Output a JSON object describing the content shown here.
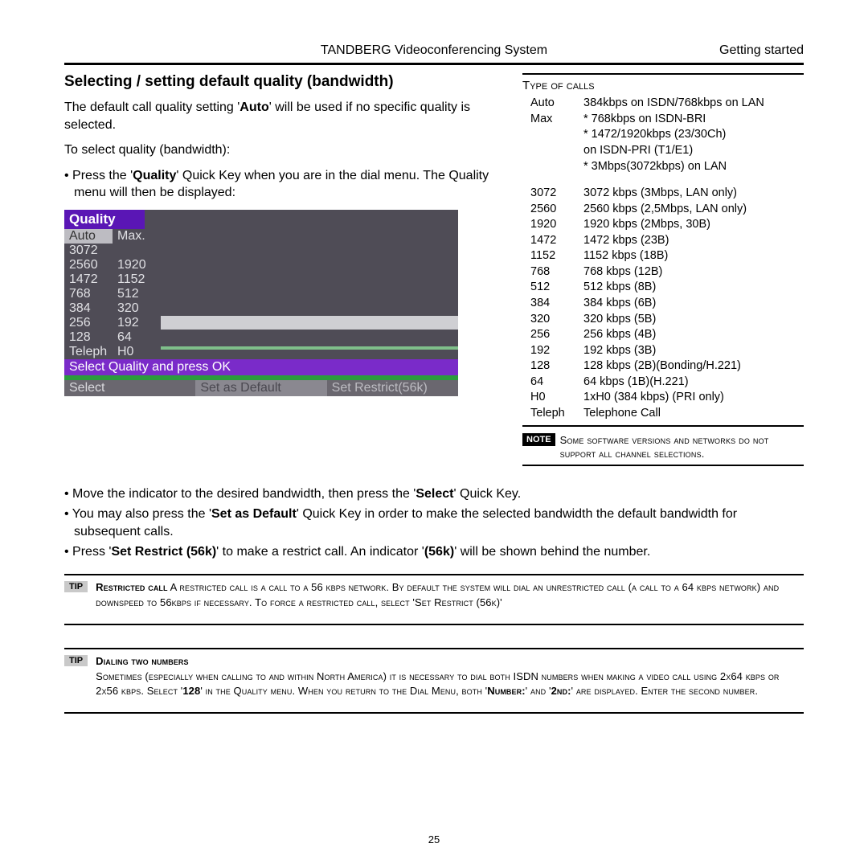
{
  "header": {
    "title": "TANDBERG Videoconferencing System",
    "right": "Getting started"
  },
  "section_heading": "Selecting / setting default quality (bandwidth)",
  "intro": {
    "p1a": "The default call quality setting '",
    "p1b": "Auto",
    "p1c": "' will be used if no specific quality is selected.",
    "p2": "To select quality (bandwidth):",
    "b1a": "Press the '",
    "b1b": "Quality",
    "b1c": "' Quick Key when you are in the dial menu. The Quality menu will then be displayed:"
  },
  "qmenu": {
    "title": "Quality",
    "rows": [
      [
        "Auto",
        "Max."
      ],
      [
        "3072",
        ""
      ],
      [
        "2560",
        "1920"
      ],
      [
        "1472",
        "1152"
      ],
      [
        "768",
        "512"
      ],
      [
        "384",
        "320"
      ],
      [
        "256",
        "192"
      ],
      [
        "128",
        "64"
      ],
      [
        "Teleph",
        "H0"
      ]
    ],
    "instruction": "Select Quality and press OK",
    "softkeys": [
      "Select",
      "Set as Default",
      "Set Restrict(56k)"
    ]
  },
  "toc": {
    "header": "Type of calls",
    "rows": [
      [
        "Auto",
        "384kbps on ISDN/768kbps on LAN"
      ],
      [
        "Max",
        "* 768kbps on ISDN-BRI"
      ],
      [
        "",
        "* 1472/1920kbps (23/30Ch)"
      ],
      [
        "",
        " on ISDN-PRI (T1/E1)"
      ],
      [
        "",
        "* 3Mbps(3072kbps)  on LAN"
      ],
      [
        "",
        ""
      ],
      [
        "3072",
        "3072 kbps (3Mbps, LAN only)"
      ],
      [
        "2560",
        "2560 kbps (2,5Mbps, LAN only)"
      ],
      [
        "1920",
        "1920 kbps (2Mbps, 30B)"
      ],
      [
        "1472",
        "1472 kbps (23B)"
      ],
      [
        "1152",
        "1152 kbps (18B)"
      ],
      [
        "768",
        "768 kbps (12B)"
      ],
      [
        "512",
        "512 kbps (8B)"
      ],
      [
        "384",
        "384 kbps (6B)"
      ],
      [
        "320",
        "320 kbps (5B)"
      ],
      [
        "256",
        "256 kbps (4B)"
      ],
      [
        "192",
        "192 kbps (3B)"
      ],
      [
        "128",
        "128 kbps (2B)(Bonding/H.221)"
      ],
      [
        "64",
        "64 kbps (1B)(H.221)"
      ],
      [
        "H0",
        "1xH0 (384 kbps) (PRI only)"
      ],
      [
        "Teleph",
        "Telephone Call"
      ]
    ],
    "note_label": "NOTE",
    "note_text": "Some software versions and networks do not support all channel selections."
  },
  "below_bullets": {
    "b1a": "Move the indicator to the desired bandwidth, then press the '",
    "b1b": "Select",
    "b1c": "' Quick Key.",
    "b2a": "You may also press the '",
    "b2b": "Set as Default",
    "b2c": "' Quick Key in order to make the selected bandwidth the default bandwidth for subsequent calls.",
    "b3a": "Press '",
    "b3b": "Set Restrict (56k)",
    "b3c": "' to make a restrict call. An indicator '",
    "b3d": "(56k)",
    "b3e": "' will be shown behind the number."
  },
  "tips": {
    "label": "TIP",
    "tip1_title": "Restricted call",
    "tip1_body": " A restricted call is a call to a 56 kbps network. By default the system will dial an unrestricted call (a call to a 64 kbps network) and downspeed to 56kbps if necessary. To force a restricted call, select 'Set Restrict (56k)'",
    "tip2_title": "Dialing two numbers",
    "tip2_body_a": "Sometimes (especially when calling to and within North America) it is necessary to dial both ISDN numbers when making a video call using 2x64 kbps or 2x56 kbps. Select '",
    "tip2_body_b": "128",
    "tip2_body_c": "' in the Quality menu. When you return to the Dial Menu, both '",
    "tip2_body_d": "Number:",
    "tip2_body_e": "' and '",
    "tip2_body_f": "2nd:",
    "tip2_body_g": "' are displayed. Enter the second number."
  },
  "page_number": "25"
}
